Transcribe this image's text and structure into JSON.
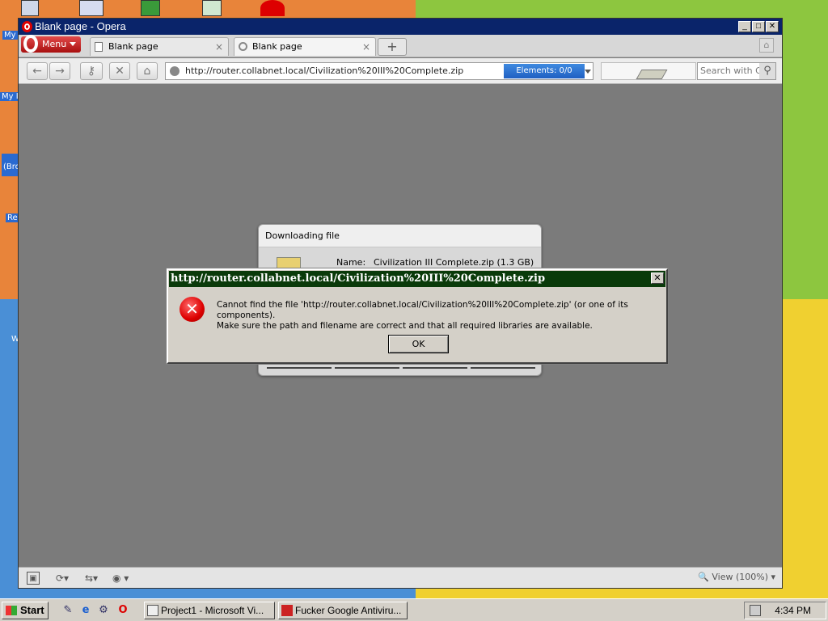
{
  "desktop": {
    "labels": [
      "My",
      "My I",
      "(Bro",
      "Re",
      "W"
    ]
  },
  "window": {
    "title": "Blank page - Opera",
    "minimize": "_",
    "maximize": "□",
    "close": "✕"
  },
  "tabs": {
    "menu_label": "Menu",
    "items": [
      {
        "label": "Blank page",
        "close": "×"
      },
      {
        "label": "Blank page",
        "close": "×"
      }
    ],
    "new_tab": "+"
  },
  "toolbar": {
    "back": "←",
    "forward": "→",
    "key": "⚷",
    "stop": "✕",
    "home": "⌂",
    "address": "http://router.collabnet.local/Civilization%20III%20Complete.zip",
    "elements_label": "Elements:",
    "elements_count": "0/0",
    "search_placeholder": "Search with Go",
    "search_icon": "⚲"
  },
  "download_dialog": {
    "title": "Downloading file",
    "name_label": "Name:",
    "name_value": "Civilization III Complete.zip (1.3 GB)"
  },
  "error_dialog": {
    "title": "http://router.collabnet.local/Civilization%20III%20Complete.zip",
    "close": "✕",
    "icon": "✕",
    "message_line1": "Cannot find the file 'http://router.collabnet.local/Civilization%20III%20Complete.zip' (or one of its components).",
    "message_line2": "Make sure the path and filename are correct and that all required libraries are available.",
    "ok_label": "OK"
  },
  "statusbar": {
    "panel": "▣",
    "sync": "⟳▾",
    "share": "⇆▾",
    "turbo": "◉ ▾",
    "view": "🔍 View (100%) ▾"
  },
  "taskbar": {
    "start_label": "Start",
    "quick_launch": [
      "✎",
      "e",
      "⚙",
      "O"
    ],
    "tasks": [
      {
        "label": "Project1 - Microsoft Vi..."
      },
      {
        "label": "Fucker Google Antiviru..."
      }
    ],
    "clock": "4:34 PM"
  },
  "colors": {
    "titlebar": "#0a246a",
    "error_title": "#0a3a0a",
    "error_icon": "#dd0000",
    "elements_bg": "#2a6ad0",
    "opera_red": "#cc1111"
  }
}
